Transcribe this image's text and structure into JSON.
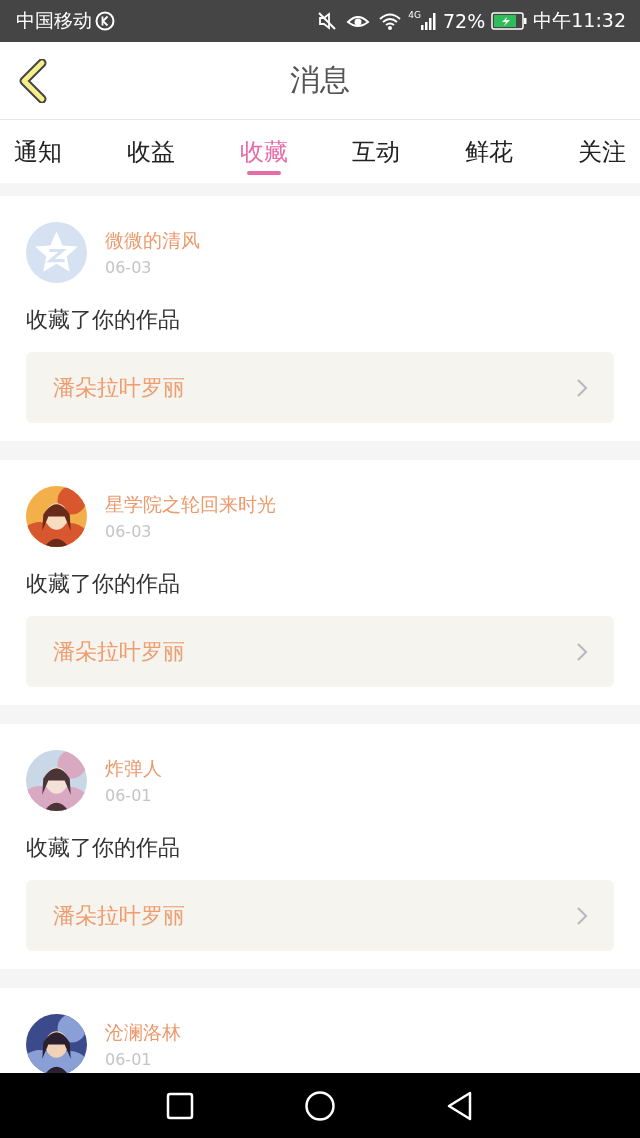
{
  "status_bar": {
    "carrier": "中国移动",
    "network": "4G",
    "battery": "72%",
    "time": "中午11:32"
  },
  "header": {
    "title": "消息"
  },
  "tabs": [
    {
      "label": "通知",
      "selected": false
    },
    {
      "label": "收益",
      "selected": false
    },
    {
      "label": "收藏",
      "selected": true
    },
    {
      "label": "互动",
      "selected": false
    },
    {
      "label": "鲜花",
      "selected": false
    },
    {
      "label": "关注",
      "selected": false
    }
  ],
  "messages": [
    {
      "avatar": {
        "kind": "default"
      },
      "name": "微微的清风",
      "date": "06-03",
      "action": "收藏了你的作品",
      "work": "潘朵拉叶罗丽"
    },
    {
      "name": "星学院之轮回来时光",
      "date": "06-03",
      "action": "收藏了你的作品",
      "work": "潘朵拉叶罗丽"
    },
    {
      "name": "炸弹人",
      "date": "06-01",
      "action": "收藏了你的作品",
      "work": "潘朵拉叶罗丽"
    },
    {
      "name": "沧澜洛林",
      "date": "06-01"
    }
  ]
}
